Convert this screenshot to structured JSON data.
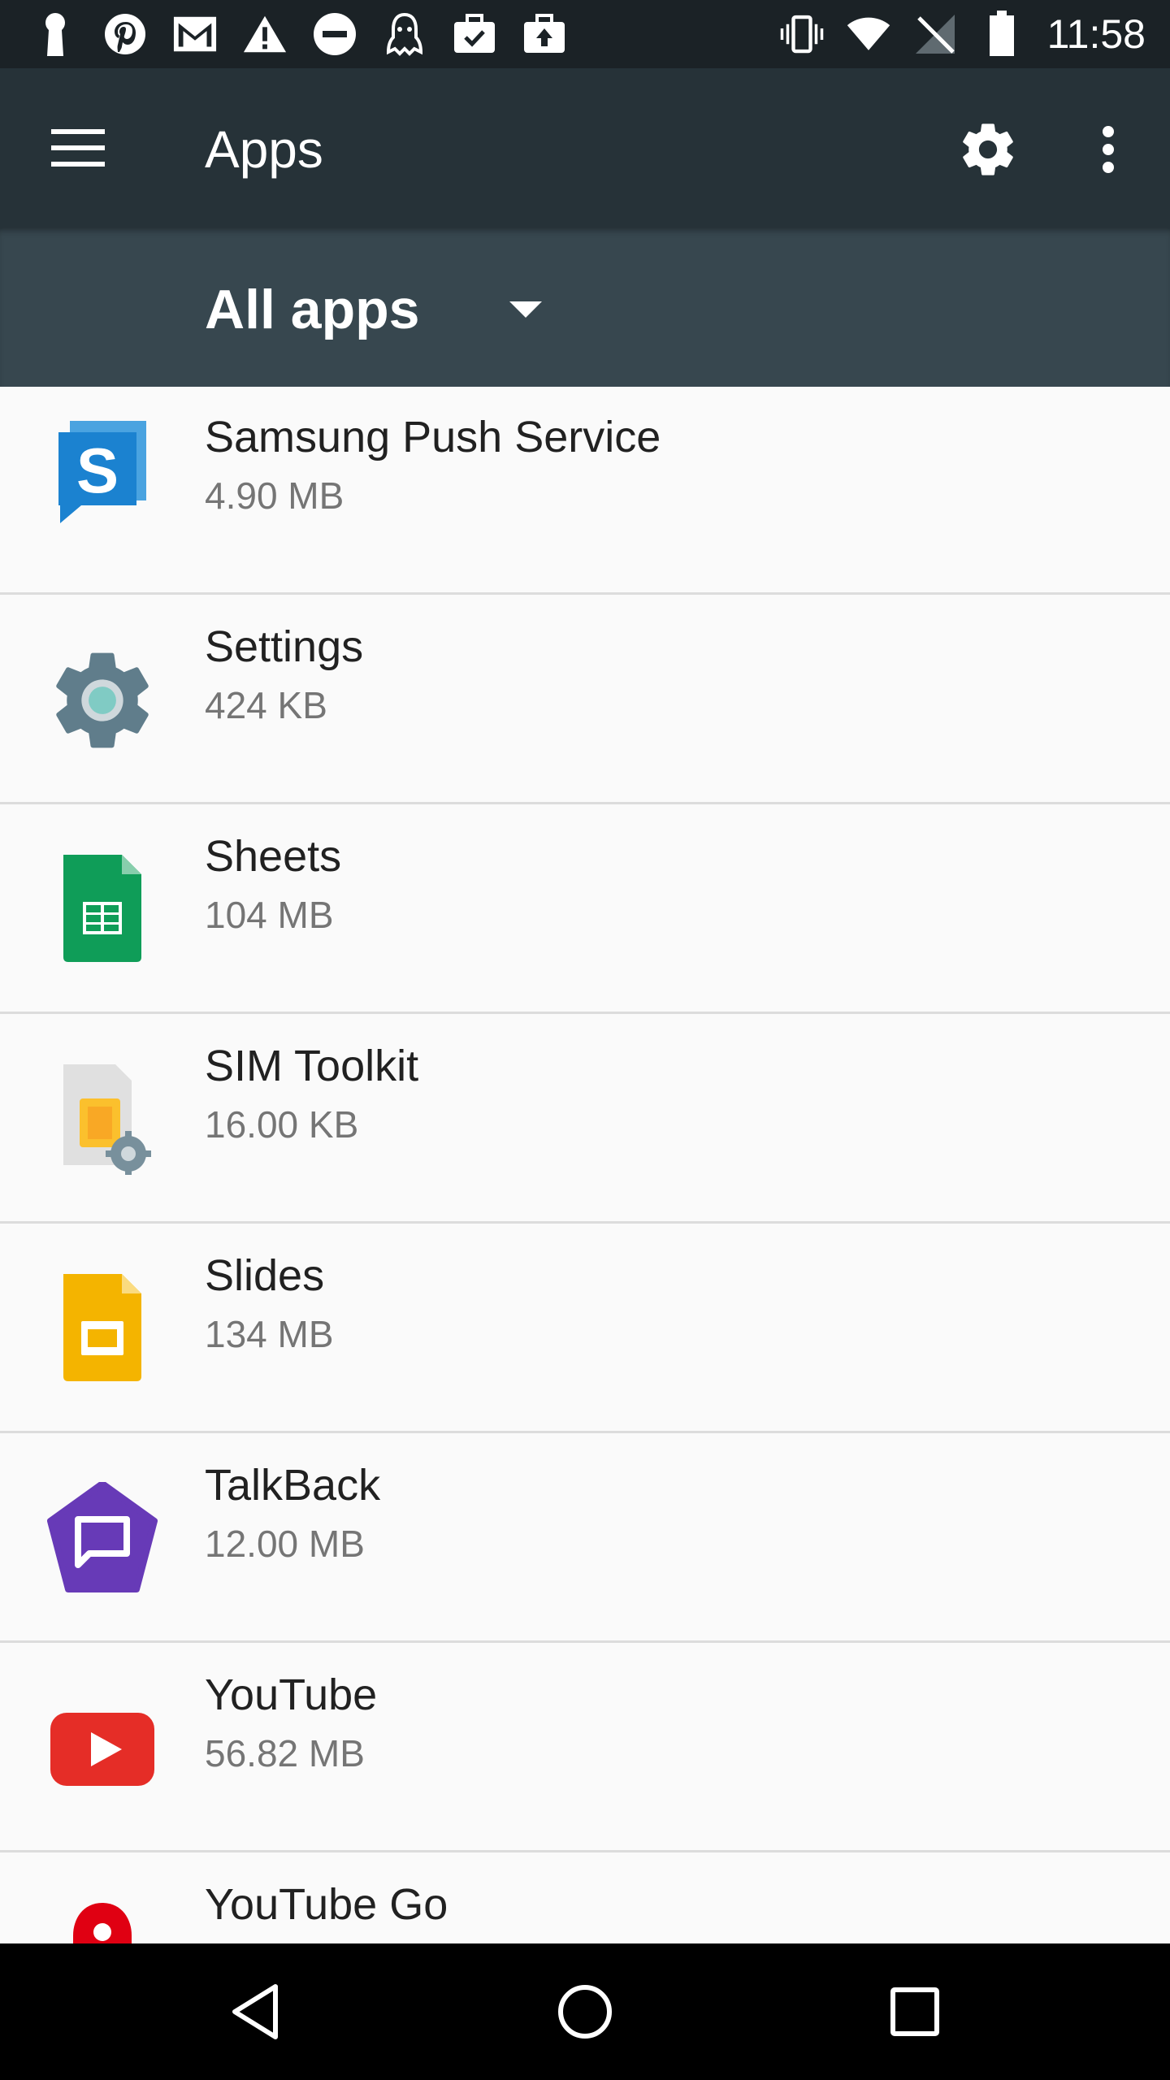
{
  "status_bar": {
    "time": "11:58",
    "left_icons": [
      "keyhole-icon",
      "pinterest-icon",
      "gmail-icon",
      "warning-icon",
      "do-not-disturb-icon",
      "ghost-icon",
      "briefcase-check-icon",
      "briefcase-upload-icon"
    ],
    "right_icons": [
      "vibrate-icon",
      "wifi-icon",
      "no-signal-icon",
      "battery-icon"
    ]
  },
  "app_bar": {
    "title": "Apps",
    "menu_icon": "hamburger-menu-icon",
    "settings_icon": "gear-icon",
    "overflow_icon": "more-vert-icon"
  },
  "filter": {
    "selected": "All apps"
  },
  "apps": [
    {
      "name": "Samsung Push Service",
      "size": "4.90 MB",
      "icon": "samsung-push-icon"
    },
    {
      "name": "Settings",
      "size": "424 KB",
      "icon": "settings-app-icon"
    },
    {
      "name": "Sheets",
      "size": "104 MB",
      "icon": "sheets-icon"
    },
    {
      "name": "SIM Toolkit",
      "size": "16.00 KB",
      "icon": "sim-toolkit-icon"
    },
    {
      "name": "Slides",
      "size": "134 MB",
      "icon": "slides-icon"
    },
    {
      "name": "TalkBack",
      "size": "12.00 MB",
      "icon": "talkback-icon"
    },
    {
      "name": "YouTube",
      "size": "56.82 MB",
      "icon": "youtube-icon"
    },
    {
      "name": "YouTube Go",
      "size": "",
      "icon": "youtube-go-icon"
    }
  ],
  "nav_bar": {
    "icons": [
      "back-icon",
      "home-icon",
      "recents-icon"
    ]
  },
  "colors": {
    "status_bar": "#1b2226",
    "app_bar": "#263238",
    "filter_bar": "#37474f",
    "list_background": "#fafafa"
  }
}
